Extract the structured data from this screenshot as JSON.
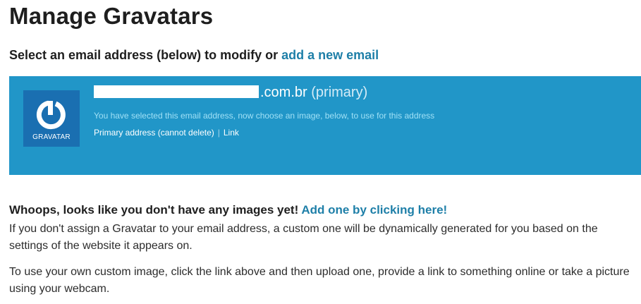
{
  "header": {
    "title": "Manage Gravatars"
  },
  "select": {
    "prefix": "Select an email address (below) to modify or ",
    "add_link": "add a new email"
  },
  "email_panel": {
    "email_suffix": ".com.br",
    "primary_tag": "(primary)",
    "notice": "You have selected this email address, now choose an image, below, to use for this address",
    "status": "Primary address (cannot delete)",
    "separator": "|",
    "link_label": "Link",
    "logo_text": "GRAVATAR",
    "logo_icon": "gravatar-logo-icon"
  },
  "empty_state": {
    "heading": "Whoops, looks like you don't have any images yet!",
    "add_link": "Add one by clicking here!",
    "paragraph_1": "If you don't assign a Gravatar to your email address, a custom one will be dynamically generated for you based on the settings of the website it appears on.",
    "paragraph_2": "To use your own custom image, click the link above and then upload one, provide a link to something online or take a picture using your webcam."
  },
  "colors": {
    "panel_bg": "#2196c8",
    "logo_bg": "#1a6fb1",
    "link": "#1e7fa8",
    "notice_text": "#9fe0f6"
  }
}
